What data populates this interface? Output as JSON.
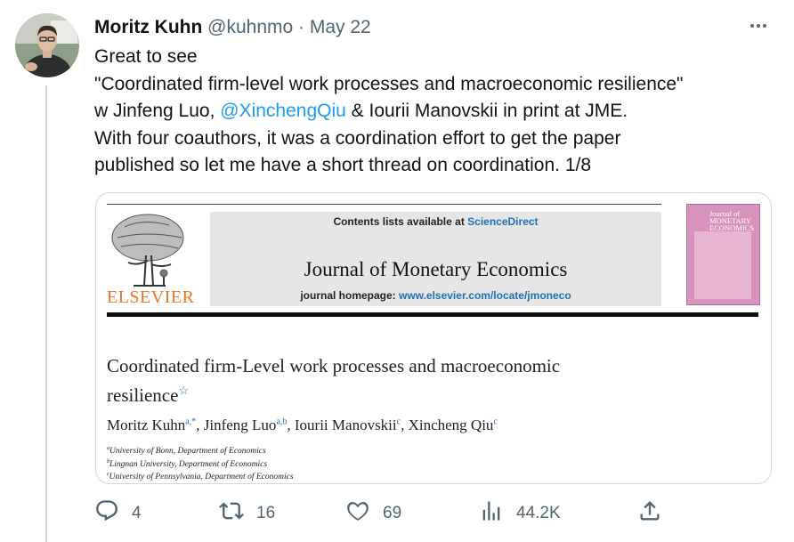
{
  "tweet": {
    "author_name": "Moritz Kuhn",
    "handle": "@kuhnmo",
    "separator": "·",
    "date": "May 22",
    "more_icon": "more-horizontal-icon",
    "text": {
      "line1": "Great to see",
      "line2": "\"Coordinated firm-level work processes and macroeconomic resilience\"",
      "line3_prefix": "w Jinfeng Luo, ",
      "line3_mention": "@XinchengQiu",
      "line3_suffix": " & Iourii Manovskii in print at JME.",
      "line4": "With four coauthors, it was a coordination effort to get the paper",
      "line5": "published so let me have a short thread on coordination. 1/8"
    }
  },
  "paper_card": {
    "contents_prefix": "Contents lists available at ",
    "contents_link": "ScienceDirect",
    "journal_title": "Journal of Monetary Economics",
    "homepage_prefix": "journal homepage: ",
    "homepage_url": "www.elsevier.com/locate/jmoneco",
    "publisher": "ELSEVIER",
    "cover_title": "Journal of MONETARY ECONOMICS",
    "paper_title_line1": "Coordinated firm-Level work processes and macroeconomic",
    "paper_title_line2": "resilience",
    "title_mark": "☆",
    "authors": [
      {
        "name": "Moritz Kuhn",
        "sup": "a,*",
        "sep": ", "
      },
      {
        "name": "Jinfeng Luo",
        "sup": "a,b",
        "sep": ", "
      },
      {
        "name": "Iourii Manovskii",
        "sup": "c",
        "sep": ", "
      },
      {
        "name": "Xincheng Qiu",
        "sup": "c",
        "sep": ""
      }
    ],
    "affiliations": [
      {
        "sup": "a",
        "text": "University of Bonn, Department of Economics"
      },
      {
        "sup": "b",
        "text": "Lingnan University, Department of Economics"
      },
      {
        "sup": "c",
        "text": "University of Pennsylvania, Department of Economics"
      }
    ]
  },
  "actions": {
    "reply": {
      "icon": "reply-icon",
      "count": "4"
    },
    "retweet": {
      "icon": "retweet-icon",
      "count": "16"
    },
    "like": {
      "icon": "heart-icon",
      "count": "69"
    },
    "views": {
      "icon": "views-chart-icon",
      "count": "44.2K"
    },
    "share": {
      "icon": "share-icon"
    }
  },
  "colors": {
    "link": "#1d9bf0",
    "muted": "#536471",
    "text": "#0f1419",
    "elsevier_orange": "#e87722",
    "cover_pink": "#d793bd"
  }
}
